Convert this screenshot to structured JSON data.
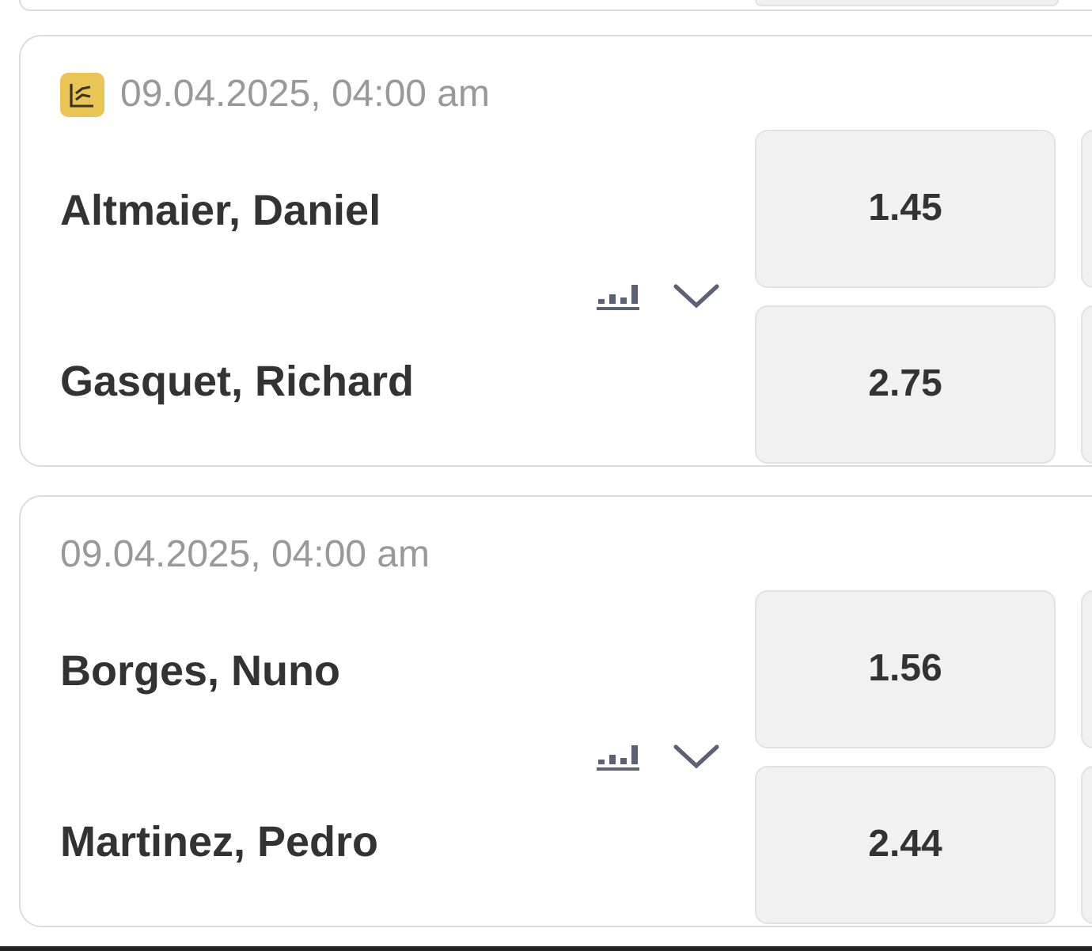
{
  "events": [
    {
      "date": "09.04.2025, 04:00 am",
      "stats_badge": true,
      "players": [
        {
          "name": "Altmaier, Daniel",
          "odds": "1.45"
        },
        {
          "name": "Gasquet, Richard",
          "odds": "2.75"
        }
      ]
    },
    {
      "date": "09.04.2025, 04:00 am",
      "stats_badge": false,
      "players": [
        {
          "name": "Borges, Nuno",
          "odds": "1.56"
        },
        {
          "name": "Martinez, Pedro",
          "odds": "2.44"
        }
      ]
    }
  ]
}
